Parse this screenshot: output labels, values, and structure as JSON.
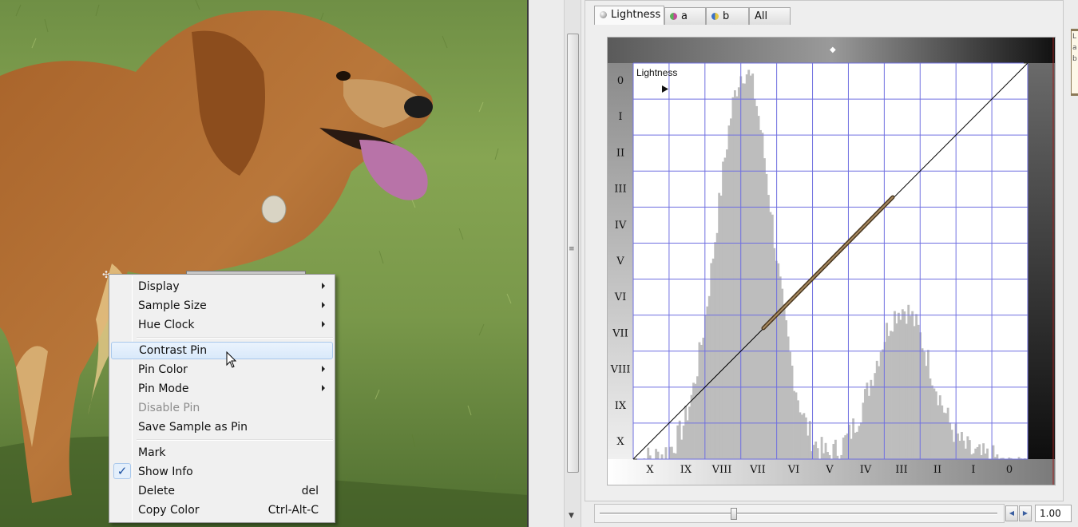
{
  "photo": {
    "description_icon": "dog-photo"
  },
  "tabs": [
    {
      "label": "Lightness",
      "color": "#8a8a8a",
      "active": true
    },
    {
      "label": "a",
      "color": "#c04a9a",
      "active": false
    },
    {
      "label": "b",
      "color": "#6aa040",
      "active": false
    },
    {
      "label": "All",
      "color": "",
      "active": false
    }
  ],
  "curve": {
    "channel_label": "Lightness",
    "y_ticks": [
      "0",
      "I",
      "II",
      "III",
      "IV",
      "V",
      "VI",
      "VII",
      "VIII",
      "IX",
      "X"
    ],
    "x_ticks": [
      "X",
      "IX",
      "VIII",
      "VII",
      "VI",
      "V",
      "IV",
      "III",
      "II",
      "I",
      "0"
    ],
    "grid_color": "#6f6fe0",
    "histogram_color": "#bdbdbd",
    "contrast_pin_color": "#7a6040"
  },
  "menu": {
    "items": [
      {
        "label": "Display",
        "submenu": true
      },
      {
        "label": "Sample Size",
        "submenu": true
      },
      {
        "label": "Hue Clock",
        "submenu": true
      },
      {
        "label": "Contrast Pin",
        "highlighted": true
      },
      {
        "label": "Pin Color",
        "submenu": true
      },
      {
        "label": "Pin Mode",
        "submenu": true
      },
      {
        "label": "Disable Pin",
        "disabled": true
      },
      {
        "label": "Save Sample as Pin"
      },
      {
        "label": "Mark"
      },
      {
        "label": "Show Info",
        "checked": true
      },
      {
        "label": "Delete",
        "shortcut": "del"
      },
      {
        "label": "Copy Color",
        "shortcut": "Ctrl-Alt-C"
      }
    ]
  },
  "zoom": {
    "value": "1.00"
  },
  "side_strip": {
    "text": "L a b"
  }
}
